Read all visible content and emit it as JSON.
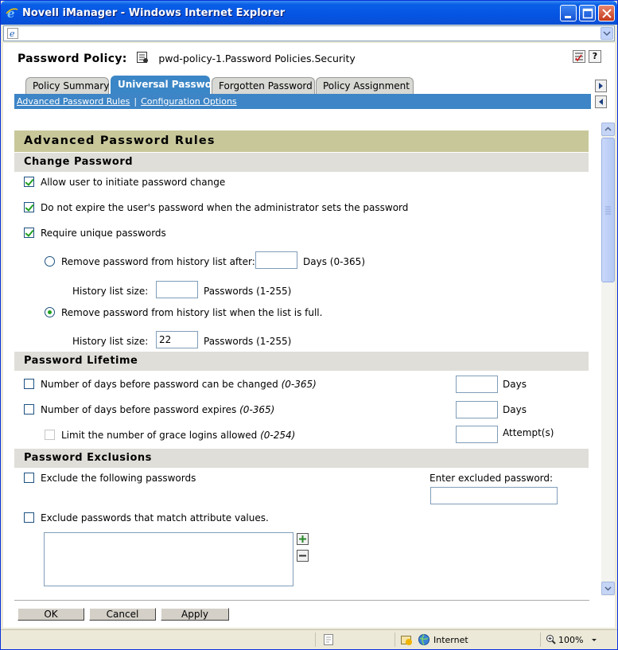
{
  "window": {
    "title": "Novell iManager - Windows Internet Explorer"
  },
  "header": {
    "label": "Password Policy:",
    "value": "pwd-policy-1.Password Policies.Security"
  },
  "tabs": [
    {
      "label": "Policy Summary",
      "active": false
    },
    {
      "label": "Universal Password",
      "active": true
    },
    {
      "label": "Forgotten Password",
      "active": false
    },
    {
      "label": "Policy Assignment",
      "active": false
    }
  ],
  "subnav": {
    "link1": "Advanced Password Rules",
    "separator": "|",
    "link2": "Configuration Options"
  },
  "main": {
    "section_title": "Advanced Password Rules",
    "change_password": {
      "title": "Change Password",
      "allow_initiate": "Allow user to initiate password change",
      "no_expire": "Do not expire the user's password when the administrator sets the password",
      "require_unique": "Require unique passwords",
      "remove_after": "Remove password from history list after:",
      "days_range": "Days (0-365)",
      "remove_after_value": "",
      "history_size_label": "History list size:",
      "history_size_value_1": "",
      "passwords_range": "Passwords (1-255)",
      "remove_when_full": "Remove password from history list when the list is full.",
      "history_size_value_2": "22"
    },
    "lifetime": {
      "title": "Password Lifetime",
      "days_before_change": "Number of days before password can be changed",
      "days_before_change_range": "(0-365)",
      "days_before_expire": "Number of days before password expires",
      "days_before_expire_range": "(0-365)",
      "grace_logins": "Limit the number of grace logins allowed",
      "grace_logins_range": "(0-254)",
      "days_unit": "Days",
      "attempts_unit": "Attempt(s)"
    },
    "exclusions": {
      "title": "Password Exclusions",
      "exclude_following": "Exclude the following passwords",
      "enter_excluded": "Enter excluded password:",
      "exclude_attr": "Exclude passwords that match attribute values."
    }
  },
  "footer": {
    "ok": "OK",
    "cancel": "Cancel",
    "apply": "Apply"
  },
  "status": {
    "zone": "Internet",
    "zoom": "100%"
  }
}
